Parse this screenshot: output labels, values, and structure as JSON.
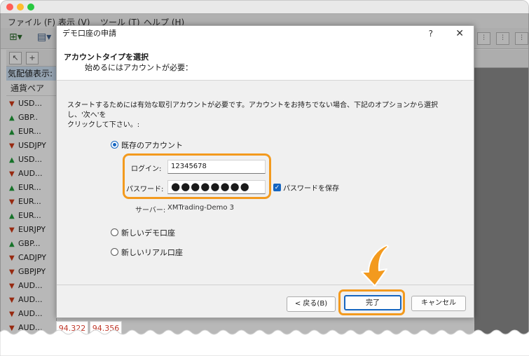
{
  "colors": {
    "accent_orange": "#f39a1e",
    "selection_blue": "#1565c0",
    "up_green": "#1f9e3a",
    "down_red": "#d23a17"
  },
  "app": {
    "menu": [
      "ファイル (F)",
      "表示 (V)",
      "ツール (T)",
      "ヘルプ (H)"
    ]
  },
  "market_watch": {
    "heading": "気配値表示:",
    "column_header": "通貨ペア",
    "rows": [
      {
        "symbol": "USD...",
        "dir": "down"
      },
      {
        "symbol": "GBP..",
        "dir": "up"
      },
      {
        "symbol": "EUR...",
        "dir": "up"
      },
      {
        "symbol": "USDJPY",
        "dir": "down"
      },
      {
        "symbol": "USD...",
        "dir": "up"
      },
      {
        "symbol": "AUD...",
        "dir": "down"
      },
      {
        "symbol": "EUR...",
        "dir": "up"
      },
      {
        "symbol": "EUR...",
        "dir": "down"
      },
      {
        "symbol": "EUR...",
        "dir": "up"
      },
      {
        "symbol": "EURJPY",
        "dir": "down"
      },
      {
        "symbol": "GBP...",
        "dir": "up"
      },
      {
        "symbol": "CADJPY",
        "dir": "down"
      },
      {
        "symbol": "GBPJPY",
        "dir": "down"
      },
      {
        "symbol": "AUD...",
        "dir": "down"
      },
      {
        "symbol": "AUD...",
        "dir": "down"
      },
      {
        "symbol": "AUD...",
        "dir": "down"
      },
      {
        "symbol": "AUD...",
        "dir": "down"
      }
    ],
    "bid": "94.322",
    "ask": "94.356"
  },
  "dialog": {
    "title": "デモ口座の申請",
    "help": "?",
    "close": "✕",
    "header_title": "アカウントタイプを選択",
    "header_subtitle": "始めるにはアカウントが必要：",
    "instruction_line1": "スタートするためには有効な取引アカウントが必要です。アカウントをお持ちでない場合、下記のオプションから選択し、'次へ'を",
    "instruction_line2": "クリックして下さい。:",
    "options": {
      "existing": "既存のアカウント",
      "new_demo": "新しいデモ口座",
      "new_real": "新しいリアル口座"
    },
    "login_label": "ログイン:",
    "login_value": "12345678",
    "password_label": "パスワード:",
    "password_value": "●●●●●●●●",
    "save_password_label": "パスワードを保存",
    "server_label": "サーバー:",
    "server_value": "XMTrading-Demo 3",
    "buttons": {
      "back": "< 戻る(B)",
      "finish": "完了",
      "cancel": "キャンセル"
    }
  }
}
